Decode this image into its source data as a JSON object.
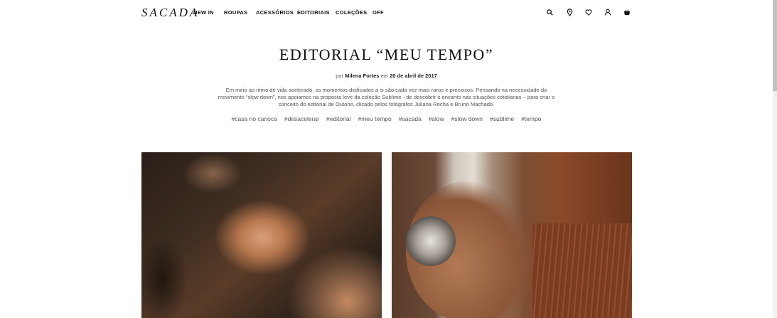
{
  "header": {
    "logo": "SACADA",
    "nav": [
      {
        "id": "new-in",
        "label": "NEW IN"
      },
      {
        "id": "roupas",
        "label": "ROUPAS"
      },
      {
        "id": "acessorios",
        "label": "ACESSÓRIOS"
      },
      {
        "id": "editoriais",
        "label": "EDITORIAIS"
      },
      {
        "id": "colecoes",
        "label": "COLEÇÕES"
      },
      {
        "id": "off",
        "label": "OFF"
      }
    ],
    "icons": [
      "search-icon",
      "location-pin-icon",
      "heart-icon",
      "user-icon",
      "shopping-bag-icon"
    ]
  },
  "article": {
    "title": "EDITORIAL “MEU TEMPO”",
    "byline_prefix": "por",
    "author": "Milena Fortes",
    "byline_mid": "em",
    "date": "20 de abril de 2017",
    "intro": "Em meio ao ritmo de vida acelerado, os momentos dedicados a si são cada vez mais raros e preciosos. Pensando na necessidade do movimento “slow down”, nos apoiamos na proposta leve da coleção Sublime - de descobrir o encanto nas situações cotidianas – para criar o conceito do editorial de Outono, clicado pelos fotógrafos Juliana Rocha e Bruno Machado.",
    "tags": [
      "#casa rio carioca",
      "#desacelerar",
      "#editorial",
      "#meu tempo",
      "#sacada",
      "#slow",
      "#slow down",
      "#sublime",
      "#tempo"
    ]
  },
  "colors": {
    "text": "#111111",
    "muted": "#555555",
    "background": "#ffffff"
  }
}
